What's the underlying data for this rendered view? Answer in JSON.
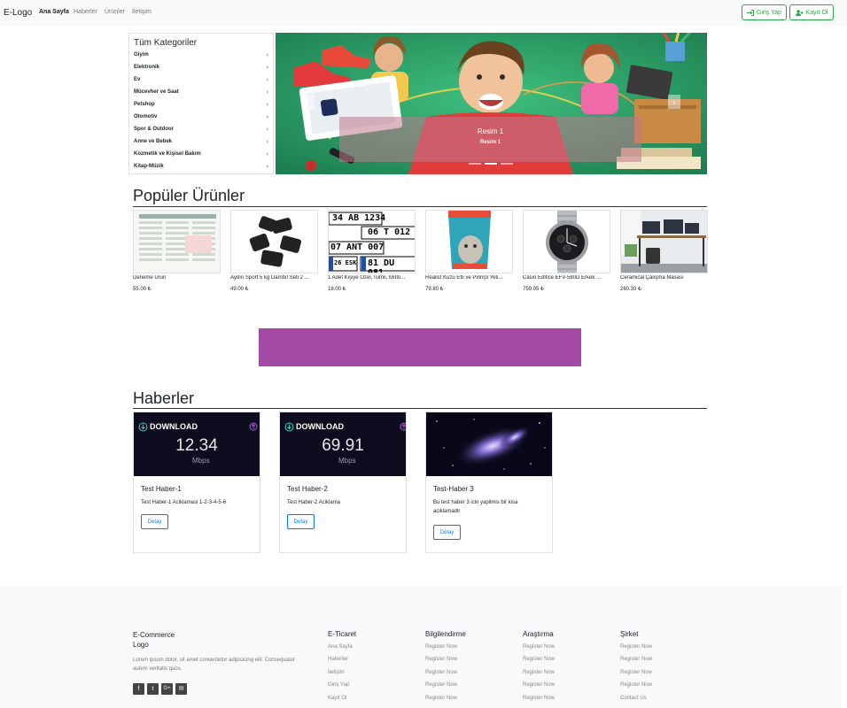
{
  "navbar": {
    "brand": "E-Logo",
    "links": [
      "Ana Sayfa",
      "Haberler",
      "Ürünler",
      "İletişim"
    ],
    "login_label": "Giriş Yap",
    "register_label": "Kayıt Ol",
    "accent_color": "#28a745"
  },
  "categories": {
    "title": "Tüm Kategoriler",
    "items": [
      "Giyim",
      "Elektronik",
      "Ev",
      "Mücevher ve Saat",
      "Petshop",
      "Otomotiv",
      "Spor & Outdoor",
      "Anne ve Bebek",
      "Kozmetik ve Kişisel Bakım",
      "Kitap-Müzik"
    ]
  },
  "carousel": {
    "caption_title": "Resim 1",
    "caption_sub": "Resim 1",
    "slide_count": 3,
    "active_index": 1
  },
  "popular": {
    "title": "Popüler Ürünler",
    "products": [
      {
        "name": "Deneme Urun",
        "price": "55.00 ₺"
      },
      {
        "name": "Aydın Sport 5 kg Dambıl Seti 2 ...",
        "price": "49.00 ₺"
      },
      {
        "name": "1 Adet Kişiye Özel, İsimli, Moto...",
        "price": "18.00 ₺"
      },
      {
        "name": "Realist Kuzu Etli ve Pirinçli Yeti...",
        "price": "79.80 ₺"
      },
      {
        "name": "Casio Edifice EFV-580D Erkek ...",
        "price": "759.05 ₺"
      },
      {
        "name": "Ceramical Çalışma Masası",
        "price": "260.30 ₺"
      }
    ]
  },
  "plates": {
    "row1": "34 AB 1234",
    "row2": "06 T 012",
    "row3": "07 ANT 007",
    "row4a": "26 ESK",
    "row4b": "81 DU 081"
  },
  "ad_color": "#a34aa6",
  "news": {
    "title": "Haberler",
    "button_label": "Detay",
    "items": [
      {
        "title": "Test Haber-1",
        "desc": "Test Haber-1 Aciklamasi 1-2-3-4-5-6",
        "download_label": "DOWNLOAD",
        "speed": "12.34",
        "unit": "Mbps"
      },
      {
        "title": "Test Haber-2",
        "desc": "Test Haber-2 Aciklama",
        "download_label": "DOWNLOAD",
        "speed": "69.91",
        "unit": "Mbps"
      },
      {
        "title": "Test-Haber 3",
        "desc": "Bu test haber 3 icin yapilmis bir kisa aciklamadir"
      }
    ]
  },
  "footer": {
    "brand_line1": "E-Commerce",
    "brand_line2": "Logo",
    "text": "Lorem ipsum dolor, sit amet consectetur adipisicing elit. Consequatur autem veritatis quos.",
    "columns": [
      {
        "title": "E-Ticaret",
        "links": [
          "Ana Sayfa",
          "Haberler",
          "İletişim",
          "Giriş Yap",
          "Kayıt Ol"
        ]
      },
      {
        "title": "Bilgilendirme",
        "links": [
          "Register Now",
          "Register Now",
          "Register Now",
          "Register Now",
          "Register Now"
        ]
      },
      {
        "title": "Araştırma",
        "links": [
          "Register Now",
          "Register Now",
          "Register Now",
          "Register Now",
          "Register Now"
        ]
      },
      {
        "title": "Şirket",
        "links": [
          "Register Now",
          "Register Now",
          "Register Now",
          "Register Now",
          "Contact Us"
        ]
      }
    ],
    "social_icons": [
      "facebook-icon",
      "twitter-icon",
      "google-plus-icon",
      "mail-icon"
    ]
  }
}
